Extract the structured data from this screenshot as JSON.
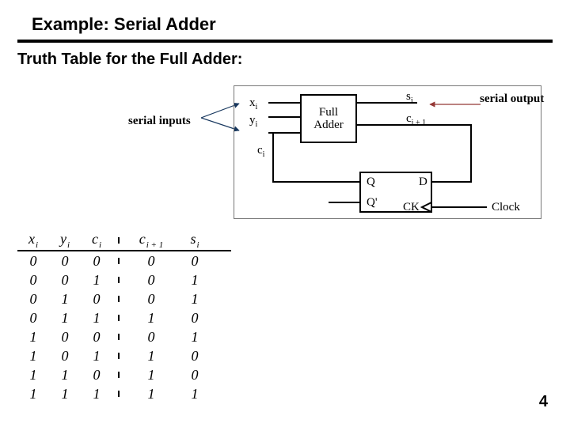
{
  "title": "Example: Serial Adder",
  "subtitle": "Truth Table for the Full Adder:",
  "ann_inputs": "serial inputs",
  "ann_output": "serial output",
  "page_number": "4",
  "diagram": {
    "x_i": "x",
    "y_i": "y",
    "s_i": "s",
    "c_i": "c",
    "c_i1_a": "c",
    "c_i1_b": "i + 1",
    "sub_i": "i",
    "full_adder_1": "Full",
    "full_adder_2": "Adder",
    "Q": "Q",
    "Qp": "Q'",
    "D": "D",
    "CK": "CK",
    "Clock": "Clock"
  },
  "chart_data": {
    "type": "table",
    "columns": [
      "x_i",
      "y_i",
      "c_i",
      "c_{i+1}",
      "s_i"
    ],
    "rows": [
      [
        0,
        0,
        0,
        0,
        0
      ],
      [
        0,
        0,
        1,
        0,
        1
      ],
      [
        0,
        1,
        0,
        0,
        1
      ],
      [
        0,
        1,
        1,
        1,
        0
      ],
      [
        1,
        0,
        0,
        0,
        1
      ],
      [
        1,
        0,
        1,
        1,
        0
      ],
      [
        1,
        1,
        0,
        1,
        0
      ],
      [
        1,
        1,
        1,
        1,
        1
      ]
    ]
  }
}
